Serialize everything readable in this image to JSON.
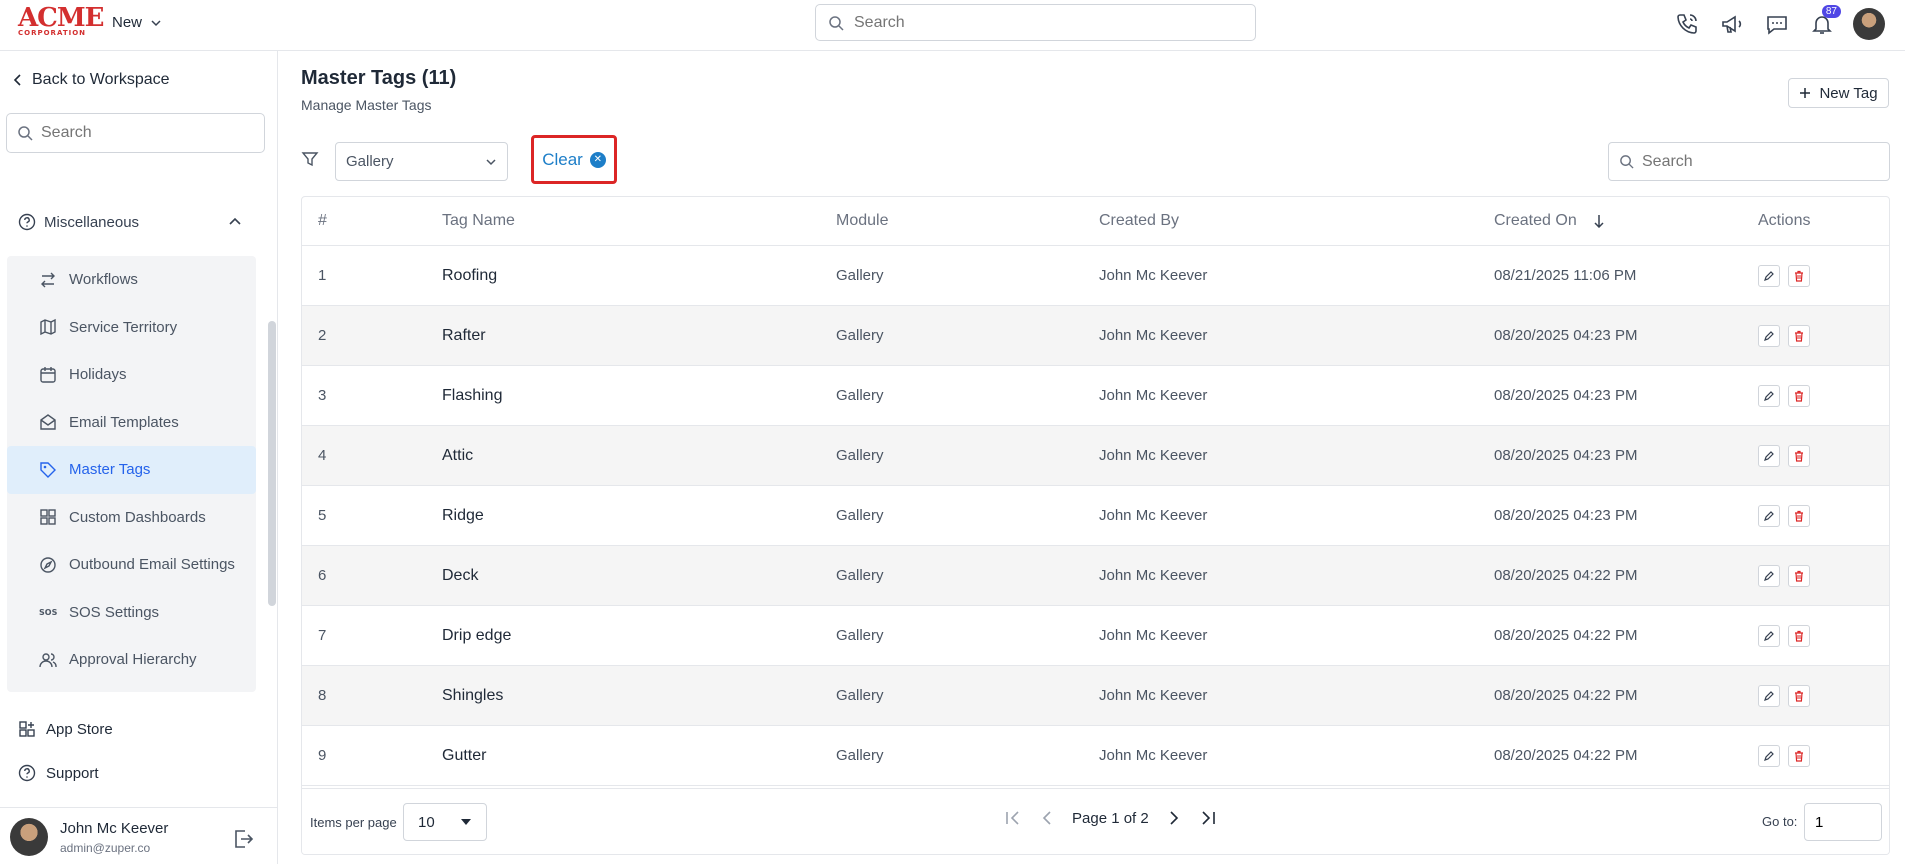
{
  "topbar": {
    "logo_main": "ACME",
    "logo_sub": "CORPORATION",
    "new_label": "New",
    "search_placeholder": "Search",
    "notification_count": "87"
  },
  "sidebar": {
    "back_label": "Back to Workspace",
    "search_placeholder": "Search",
    "section_label": "Miscellaneous",
    "items": [
      {
        "label": "Workflows",
        "icon": "workflow-icon"
      },
      {
        "label": "Service Territory",
        "icon": "map-icon"
      },
      {
        "label": "Holidays",
        "icon": "calendar-icon"
      },
      {
        "label": "Email Templates",
        "icon": "mail-open-icon"
      },
      {
        "label": "Master Tags",
        "icon": "tag-icon",
        "active": true
      },
      {
        "label": "Custom Dashboards",
        "icon": "dashboard-icon"
      },
      {
        "label": "Outbound Email Settings",
        "icon": "compass-icon"
      },
      {
        "label": "SOS Settings",
        "icon": "sos-icon"
      },
      {
        "label": "Approval Hierarchy",
        "icon": "users-icon"
      }
    ],
    "app_store_label": "App Store",
    "support_label": "Support",
    "user_name": "John Mc Keever",
    "user_email": "admin@zuper.co"
  },
  "main": {
    "title": "Master Tags (11)",
    "subtitle": "Manage Master Tags",
    "new_tag_label": "New Tag",
    "module_filter_value": "Gallery",
    "clear_label": "Clear",
    "search_placeholder": "Search"
  },
  "table": {
    "headers": [
      "#",
      "Tag Name",
      "Module",
      "Created By",
      "Created On",
      "Actions"
    ],
    "rows": [
      {
        "num": "1",
        "name": "Roofing",
        "module": "Gallery",
        "by": "John Mc Keever",
        "on": "08/21/2025 11:06 PM"
      },
      {
        "num": "2",
        "name": "Rafter",
        "module": "Gallery",
        "by": "John Mc Keever",
        "on": "08/20/2025 04:23 PM"
      },
      {
        "num": "3",
        "name": "Flashing",
        "module": "Gallery",
        "by": "John Mc Keever",
        "on": "08/20/2025 04:23 PM"
      },
      {
        "num": "4",
        "name": "Attic",
        "module": "Gallery",
        "by": "John Mc Keever",
        "on": "08/20/2025 04:23 PM"
      },
      {
        "num": "5",
        "name": "Ridge",
        "module": "Gallery",
        "by": "John Mc Keever",
        "on": "08/20/2025 04:23 PM"
      },
      {
        "num": "6",
        "name": "Deck",
        "module": "Gallery",
        "by": "John Mc Keever",
        "on": "08/20/2025 04:22 PM"
      },
      {
        "num": "7",
        "name": "Drip edge",
        "module": "Gallery",
        "by": "John Mc Keever",
        "on": "08/20/2025 04:22 PM"
      },
      {
        "num": "8",
        "name": "Shingles",
        "module": "Gallery",
        "by": "John Mc Keever",
        "on": "08/20/2025 04:22 PM"
      },
      {
        "num": "9",
        "name": "Gutter",
        "module": "Gallery",
        "by": "John Mc Keever",
        "on": "08/20/2025 04:22 PM"
      }
    ]
  },
  "footer": {
    "items_per_page_label": "Items per page",
    "items_per_page_value": "10",
    "page_text": "Page 1 of 2",
    "goto_label": "Go to:",
    "goto_value": "1"
  },
  "colors": {
    "accent": "#1d7ec8",
    "active_bg": "#e0eefb",
    "highlight_border": "#dc2626",
    "delete_red": "#dc2626",
    "badge": "#4f46e5"
  }
}
